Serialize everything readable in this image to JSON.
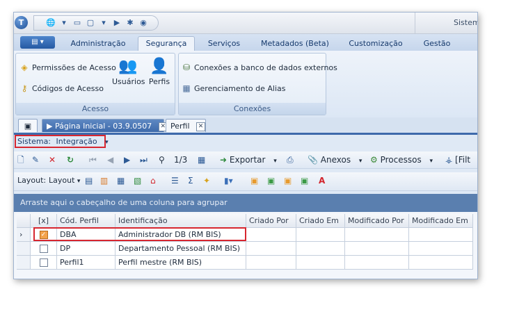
{
  "titlebar": {
    "orb": "T",
    "system_label": "Sistem"
  },
  "ribbon_tabs": [
    "Administração",
    "Segurança",
    "Serviços",
    "Metadados (Beta)",
    "Customização",
    "Gestão"
  ],
  "ribbon": {
    "acesso": {
      "label": "Acesso",
      "permissoes": "Permissões de Acesso",
      "codigos": "Códigos de Acesso",
      "usuarios": "Usuários",
      "perfis": "Perfis"
    },
    "conexoes": {
      "label": "Conexões",
      "conexoes_externos": "Conexões a banco de dados externos",
      "gerenciamento_alias": "Gerenciamento de Alias"
    }
  },
  "doc_tabs": {
    "home": "Página Inicial - 03.9.0507",
    "perfil": "Perfil"
  },
  "sistema": {
    "label": "Sistema:",
    "value": "Integração"
  },
  "toolbar": {
    "page_counter": "1/3",
    "exportar": "Exportar",
    "anexos": "Anexos",
    "processos": "Processos",
    "filtro": "[Filt"
  },
  "layout_bar": {
    "label": "Layout:",
    "dropdown": "Layout"
  },
  "grid": {
    "group_hint": "Arraste aqui o cabeçalho de uma coluna para agrupar",
    "columns": [
      "[x]",
      "Cód. Perfil",
      "Identificação",
      "Criado Por",
      "Criado Em",
      "Modificado Por",
      "Modificado Em"
    ],
    "rows": [
      {
        "checked": true,
        "code": "DBA",
        "name": "Administrador DB (RM BIS)"
      },
      {
        "checked": false,
        "code": "DP",
        "name": "Departamento Pessoal (RM BIS)"
      },
      {
        "checked": false,
        "code": "Perfil1",
        "name": "Perfil mestre (RM BIS)"
      }
    ]
  },
  "colors": {
    "accent": "#3e6aab",
    "highlight": "#d7262f",
    "group_bar": "#5a7faf"
  }
}
